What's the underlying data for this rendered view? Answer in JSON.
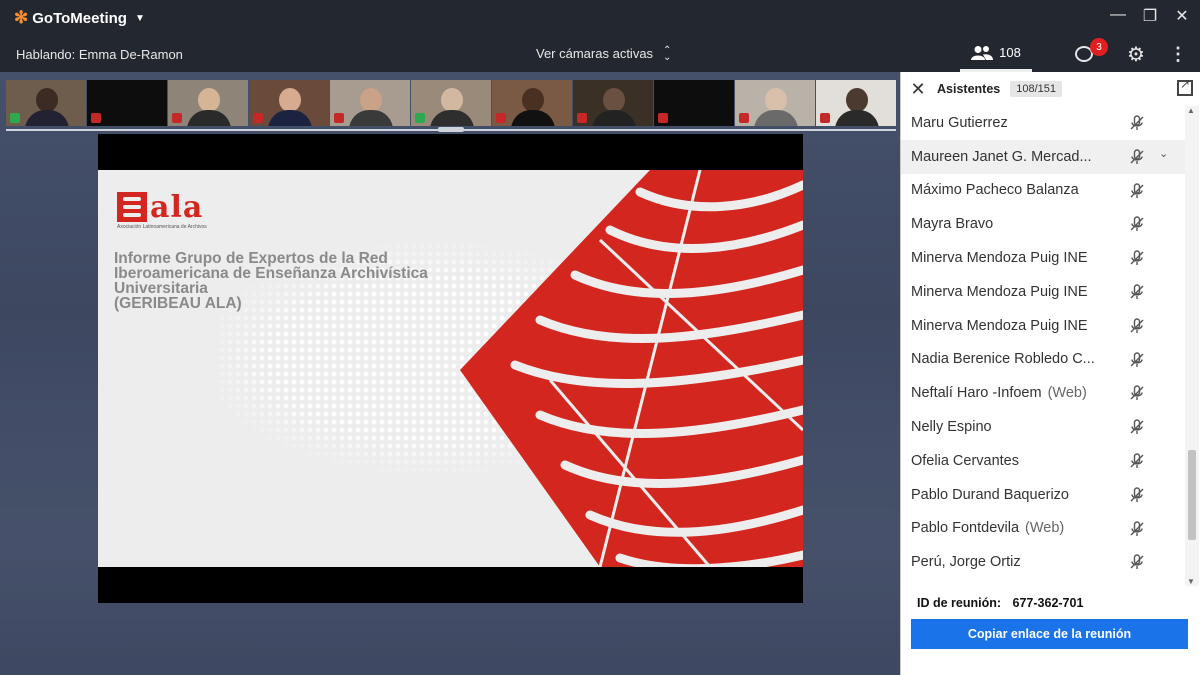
{
  "app": {
    "name": "GoToMeeting"
  },
  "toolbar": {
    "speaking": "Hablando: Emma De-Ramon",
    "cameras": "Ver cámaras activas",
    "people_count": "108",
    "chat_badge": "3"
  },
  "slide": {
    "logo_word": "ala",
    "logo_subtitle": "Asociación Latinoamericana de Archivos",
    "title_lines": [
      "Informe Grupo de Expertos de la Red",
      "Iberoamericana de Enseñanza Archivística",
      "Universitaria",
      "(GERIBEAU ALA)"
    ],
    "accent_color": "#d3261f"
  },
  "panel": {
    "title": "Asistentes",
    "count": "108/151",
    "attendees": [
      {
        "name": "Maru Gutierrez",
        "web": ""
      },
      {
        "name": "Maureen Janet G. Mercad...",
        "web": ""
      },
      {
        "name": "Máximo Pacheco Balanza",
        "web": ""
      },
      {
        "name": "Mayra Bravo",
        "web": ""
      },
      {
        "name": "Minerva Mendoza Puig INE",
        "web": ""
      },
      {
        "name": "Minerva Mendoza Puig INE",
        "web": ""
      },
      {
        "name": "Minerva Mendoza Puig INE",
        "web": ""
      },
      {
        "name": "Nadia Berenice Robledo C...",
        "web": ""
      },
      {
        "name": "Neftalí Haro -Infoem",
        "web": "(Web)"
      },
      {
        "name": "Nelly Espino",
        "web": ""
      },
      {
        "name": "Ofelia Cervantes",
        "web": ""
      },
      {
        "name": "Pablo Durand Baquerizo",
        "web": ""
      },
      {
        "name": "Pablo Fontdevila",
        "web": "(Web)"
      },
      {
        "name": "Perú, Jorge Ortiz",
        "web": ""
      }
    ],
    "meeting_id_label": "ID de reunión:",
    "meeting_id": "677-362-701",
    "copy_button": "Copiar enlace de la reunión"
  },
  "colors": {
    "brand_orange": "#f68d2e",
    "primary_blue": "#1a73e8",
    "badge_red": "#e02020"
  }
}
